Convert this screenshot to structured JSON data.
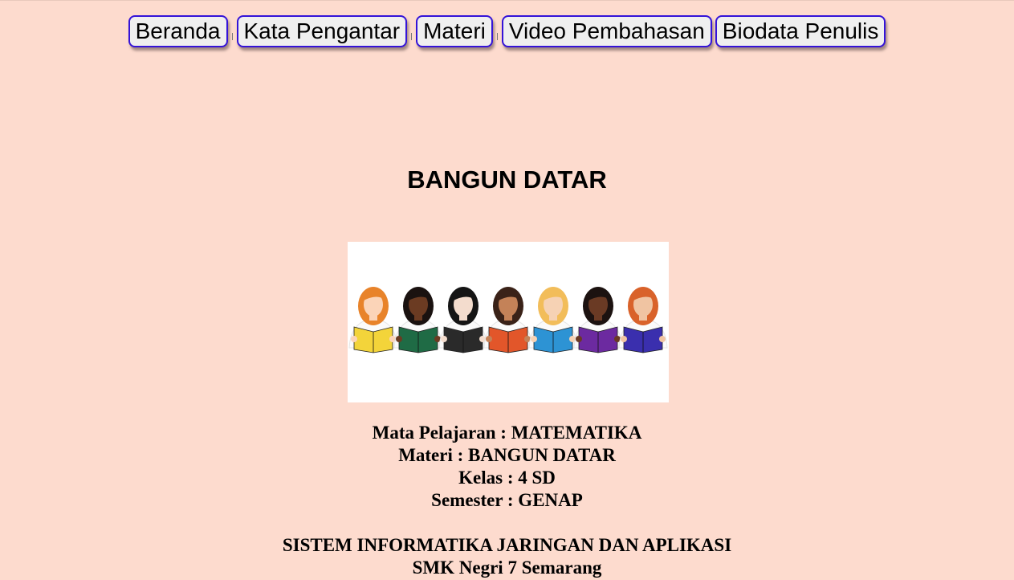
{
  "nav": {
    "items": [
      {
        "label": "Beranda"
      },
      {
        "label": "Kata Pengantar"
      },
      {
        "label": "Materi"
      },
      {
        "label": "Video Pembahasan"
      },
      {
        "label": "Biodata Penulis"
      }
    ]
  },
  "main": {
    "title": "BANGUN DATAR",
    "image": {
      "icon": "readers-illustration",
      "book_colors": [
        "#f3d43a",
        "#1f6b45",
        "#2a2a2a",
        "#e2562a",
        "#2d93d4",
        "#6c2aa0",
        "#3a2fae"
      ],
      "hair_colors": [
        "#e8832a",
        "#1a1210",
        "#151515",
        "#3a2218",
        "#f2bd5a",
        "#1c1210",
        "#d9622a"
      ],
      "skin_colors": [
        "#fbd4b8",
        "#6b3b22",
        "#f3dccd",
        "#c48258",
        "#f6d2b4",
        "#6a3a24",
        "#f0c4a2"
      ]
    },
    "info": {
      "subject": "Mata Pelajaran : MATEMATIKA",
      "material": "Materi : BANGUN DATAR",
      "grade": "Kelas : 4 SD",
      "semester": "Semester : GENAP",
      "program": "SISTEM INFORMATIKA JARINGAN DAN APLIKASI",
      "school": "SMK Negri 7 Semarang"
    }
  }
}
